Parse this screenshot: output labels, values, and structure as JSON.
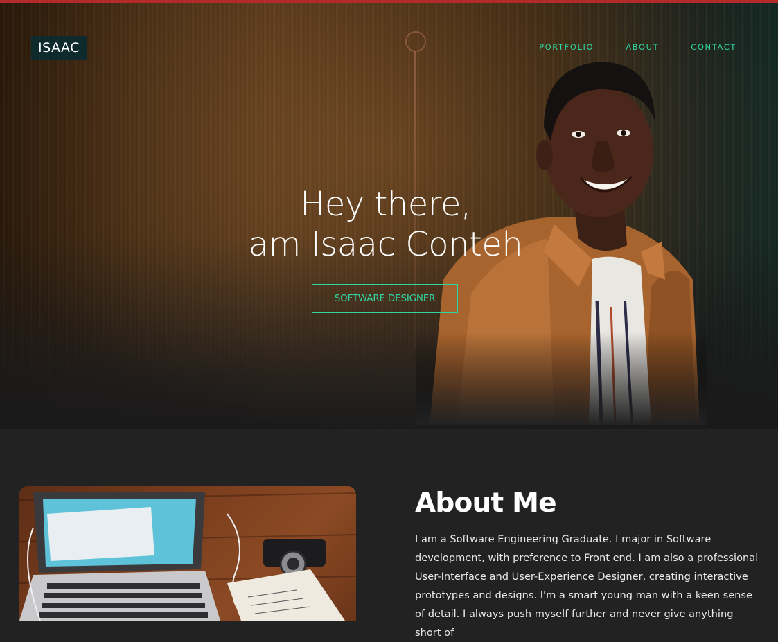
{
  "header": {
    "logo": "ISAAC",
    "nav": [
      {
        "label": "PORTFOLIO"
      },
      {
        "label": "ABOUT"
      },
      {
        "label": "CONTACT"
      }
    ]
  },
  "hero": {
    "line1": "Hey there,",
    "line2": "am Isaac Conteh",
    "role_button": "SOFTWARE DESIGNER"
  },
  "about": {
    "title": "About Me",
    "text": "I am a Software Engineering Graduate. I major in Software development, with preference to Front end. I am also a professional User-Interface and User-Experience Designer, creating interactive prototypes and designs. I'm a smart young man with a keen sense of detail. I always push myself further and never give anything short of"
  },
  "colors": {
    "accent": "#2fd6a2",
    "background": "#222223",
    "logo_bg": "#0f2a2c"
  }
}
